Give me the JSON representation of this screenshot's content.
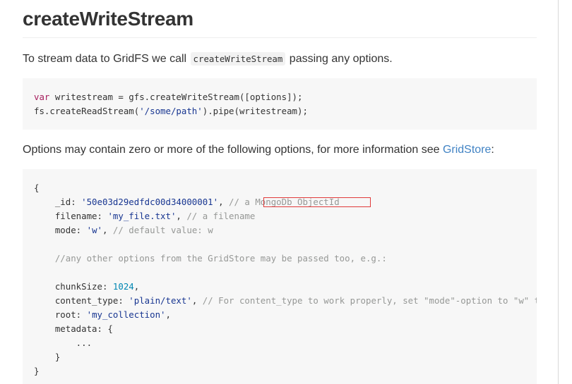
{
  "heading": "createWriteStream",
  "para1": {
    "before": "To stream data to GridFS we call ",
    "code": "createWriteStream",
    "after": " passing any options."
  },
  "code1": {
    "line1": {
      "kw": "var",
      "rest": " writestream = gfs.createWriteStream([options]);"
    },
    "line2": {
      "pre": "fs.createReadStream(",
      "str": "'/some/path'",
      "post": ").pipe(writestream);"
    }
  },
  "para2": {
    "text": "Options may contain zero or more of the following options, for more information see ",
    "link": "GridStore",
    "after": ":"
  },
  "code2": {
    "open": "{",
    "id_key": "    _id: ",
    "id_val": "'50e03d29edfdc00d34000001'",
    "id_sep": ", ",
    "id_comment_prefix": "//",
    "id_comment": " a MongoDb ObjectId",
    "filename_key": "    filename: ",
    "filename_val": "'my_file.txt'",
    "filename_sep": ", ",
    "filename_comment": "// a filename",
    "mode_key": "    mode: ",
    "mode_val": "'w'",
    "mode_sep": ", ",
    "mode_comment": "// default value: w",
    "other_comment": "    //any other options from the GridStore may be passed too, e.g.:",
    "chunk_key": "    chunkSize: ",
    "chunk_val": "1024",
    "chunk_sep": ",",
    "ctype_key": "    content_type: ",
    "ctype_val": "'plain/text'",
    "ctype_sep": ", ",
    "ctype_comment": "// For content_type to work properly, set \"mode\"-option to \"w\" too!",
    "root_key": "    root: ",
    "root_val": "'my_collection'",
    "root_sep": ",",
    "meta_line": "    metadata: {",
    "ellipsis": "        ...",
    "meta_close": "    }",
    "close": "}"
  },
  "colors": {
    "keyword": "#a71d5d",
    "string": "#183691",
    "number": "#0086b3",
    "comment": "#969896",
    "link": "#4183c4",
    "highlight_border": "#e03a3a"
  }
}
